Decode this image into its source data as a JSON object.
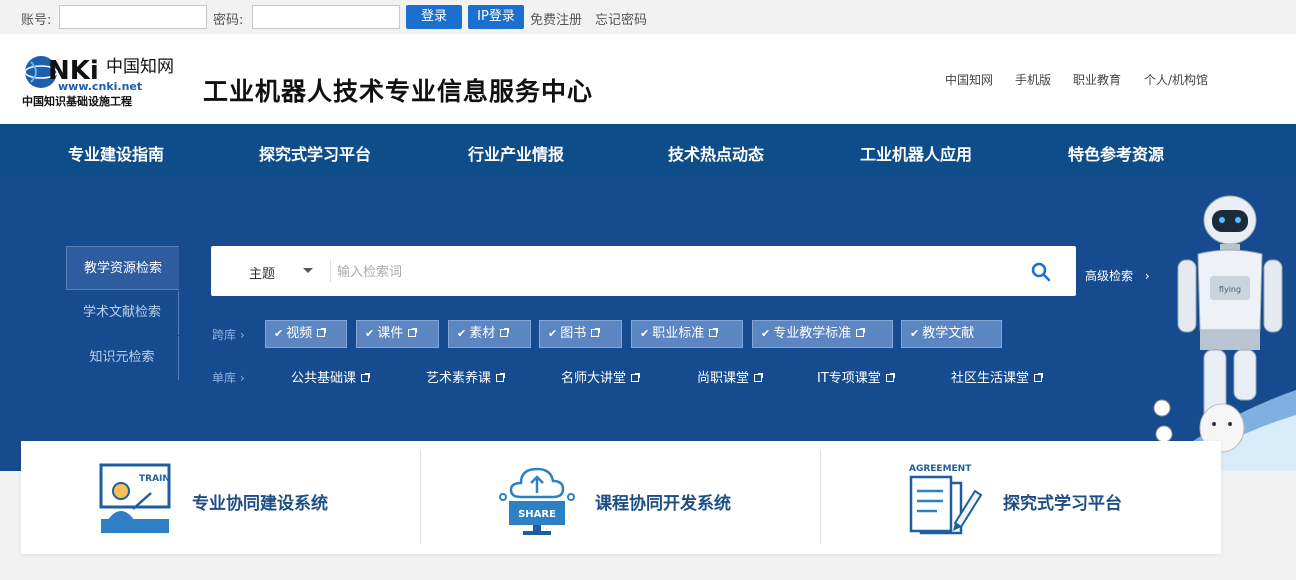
{
  "topbar": {
    "account_label": "账号:",
    "password_label": "密码:",
    "login_label": "登录",
    "ip_login_label": "IP登录",
    "register_label": "免费注册",
    "forgot_label": "忘记密码"
  },
  "header": {
    "logo_lines": [
      "中国知网",
      "www.cnki.net",
      "中国知识基础设施工程"
    ],
    "title": "工业机器人技术专业信息服务中心",
    "links": [
      "中国知网",
      "手机版",
      "职业教育",
      "个人/机构馆"
    ]
  },
  "nav": {
    "items": [
      "专业建设指南",
      "探究式学习平台",
      "行业产业情报",
      "技术热点动态",
      "工业机器人应用",
      "特色参考资源"
    ]
  },
  "search": {
    "tabs": [
      "教学资源检索",
      "学术文献检索",
      "知识元检索"
    ],
    "type_value": "主题",
    "placeholder": "输入检索词",
    "advanced_label": "高级检索",
    "cross_label": "跨库",
    "single_label": "单库",
    "cross_chips": [
      "视频",
      "课件",
      "素材",
      "图书",
      "职业标准",
      "专业教学标准",
      "教学文献"
    ],
    "single_items": [
      "公共基础课",
      "艺术素养课",
      "名师大讲堂",
      "尚职课堂",
      "IT专项课堂",
      "社区生活课堂"
    ],
    "robot_chest": "flying"
  },
  "cards": {
    "items": [
      {
        "title": "专业协同建设系统",
        "icon_text": "TRAIN"
      },
      {
        "title": "课程协同开发系统",
        "icon_text": "SHARE"
      },
      {
        "title": "探究式学习平台",
        "icon_text": "AGREEMENT"
      }
    ]
  },
  "colors": {
    "nav_bg": "#0e4d8a",
    "hero_bg": "#174b8f",
    "button": "#1a6fcf",
    "card_title": "#1d4f86"
  }
}
